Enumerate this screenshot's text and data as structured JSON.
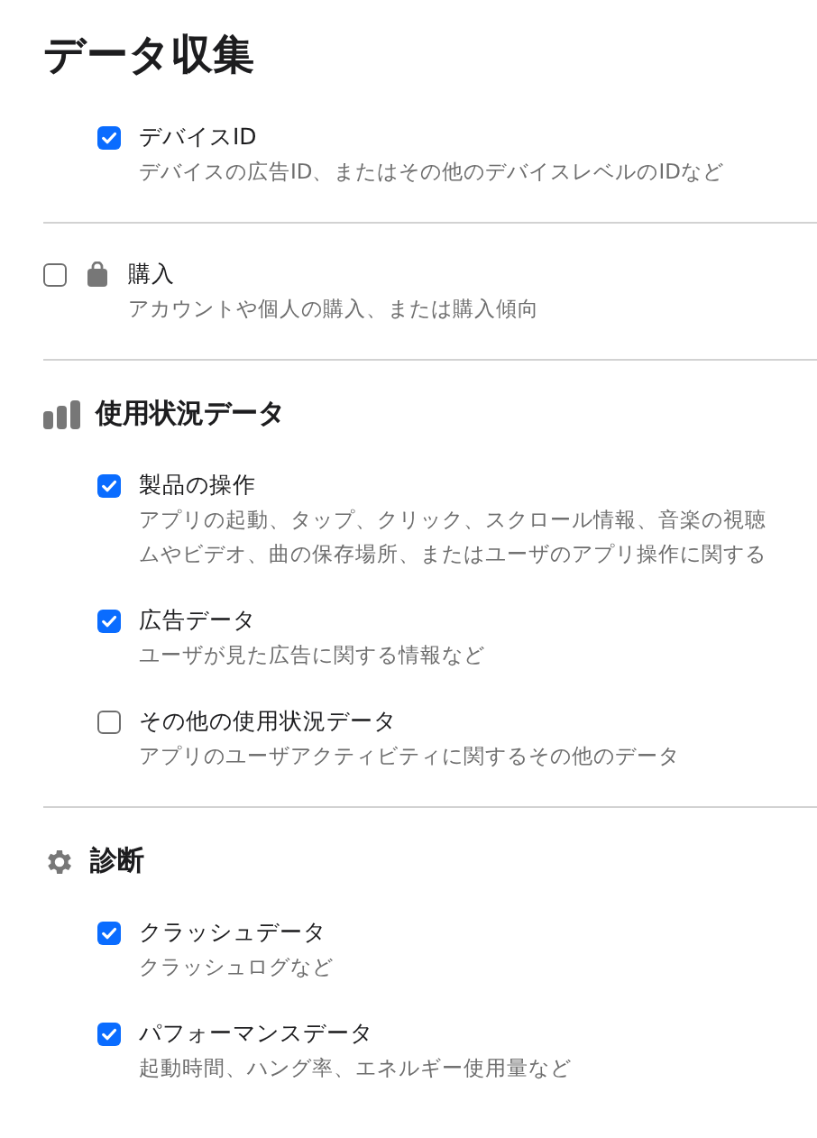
{
  "title": "データ収集",
  "sections": [
    {
      "kind": "items",
      "items": [
        {
          "label": "デバイスID",
          "checked": true,
          "lines": [
            "デバイスの広告ID、またはその他のデバイスレベルのIDなど"
          ]
        }
      ]
    },
    {
      "kind": "single",
      "label": "購入",
      "checked": false,
      "lines": [
        "アカウントや個人の購入、または購入傾向"
      ]
    },
    {
      "kind": "group",
      "heading": "使用状況データ",
      "items": [
        {
          "label": "製品の操作",
          "checked": true,
          "lines": [
            "アプリの起動、タップ、クリック、スクロール情報、音楽の視聴",
            "ムやビデオ、曲の保存場所、またはユーザのアプリ操作に関する"
          ]
        },
        {
          "label": "広告データ",
          "checked": true,
          "lines": [
            "ユーザが見た広告に関する情報など"
          ]
        },
        {
          "label": "その他の使用状況データ",
          "checked": false,
          "lines": [
            "アプリのユーザアクティビティに関するその他のデータ"
          ]
        }
      ]
    },
    {
      "kind": "group",
      "heading": "診断",
      "items": [
        {
          "label": "クラッシュデータ",
          "checked": true,
          "lines": [
            "クラッシュログなど"
          ]
        },
        {
          "label": "パフォーマンスデータ",
          "checked": true,
          "lines": [
            "起動時間、ハング率、エネルギー使用量など"
          ]
        }
      ]
    }
  ]
}
